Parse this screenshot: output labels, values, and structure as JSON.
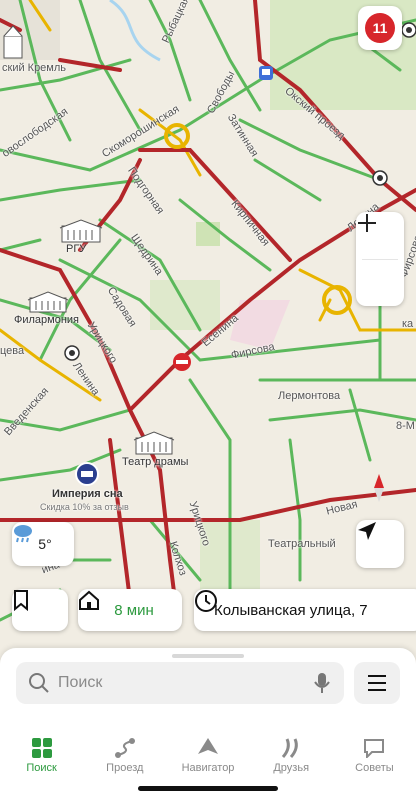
{
  "map": {
    "traffic_score": "11",
    "streets": {
      "kremlin": "ский Кремль",
      "novosobodskaya": "овослободская",
      "skomoroshinskaya": "Скоморошинская",
      "rybatskaya": "Рыбацкая",
      "svobody": "Свободы",
      "zatinnaya": "Затинная",
      "oksky": "Окский проезд",
      "podgornaya": "Подгорная",
      "shchedrina": "Щедрина",
      "sadovaya": "Садовая",
      "uritskogo": "Урицкого",
      "lenina_top": "Ленина",
      "lenina_mid": "Есенина",
      "lenina_left": "Ленина",
      "kirpichnaya": "Кирпичная",
      "firsova": "Фирсова",
      "lermontova": "Лермонтова",
      "vvedenskaya": "Введенская",
      "tsev": "цева",
      "uritskogo2": "Урицкого",
      "kolkhoznaya": "Колхоз",
      "novaya": "Новая",
      "teatralny": "Театральный",
      "firsova_r": "Фирсова",
      "right_m": "8-М",
      "right_ka": "ка",
      "ina": "ина"
    },
    "pois": {
      "rgu": "РГУ",
      "philharmonia": "Филармония",
      "drama": "Театр драмы",
      "empire": "Империя сна",
      "empire_sub": "Скидка 10% за отзыв"
    },
    "weather": {
      "temp": "5°",
      "icon": "cloud-rain-icon"
    },
    "route": {
      "time": "8 мин"
    },
    "address": {
      "text": "Колыванская улица, 7"
    }
  },
  "search": {
    "placeholder": "Поиск"
  },
  "tabs": [
    {
      "label": "Поиск"
    },
    {
      "label": "Проезд"
    },
    {
      "label": "Навигатор"
    },
    {
      "label": "Друзья"
    },
    {
      "label": "Советы"
    }
  ],
  "colors": {
    "accent": "#2d9a3f",
    "traffic_red": "#b3262a",
    "traffic_green": "#4caf50",
    "traffic_yellow": "#e8b400"
  }
}
